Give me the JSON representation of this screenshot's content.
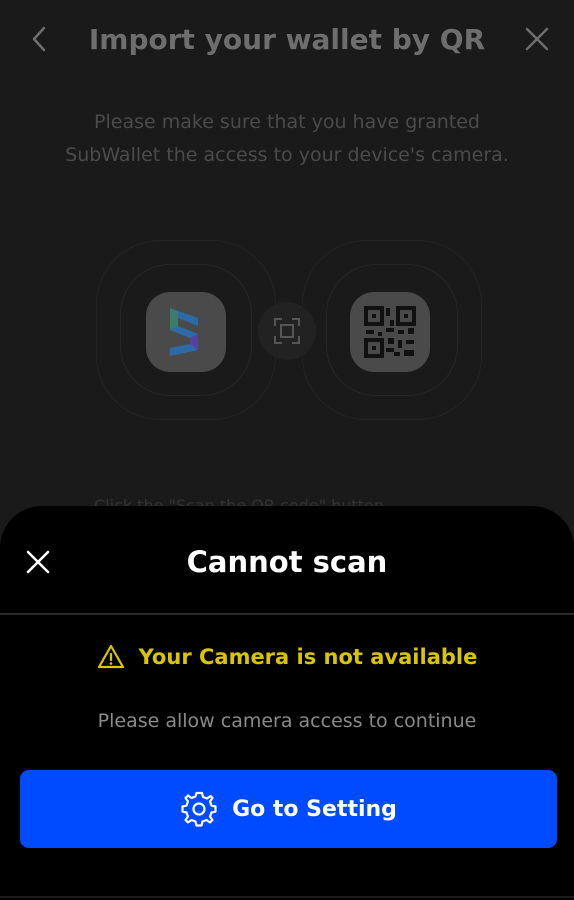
{
  "header": {
    "title": "Import your wallet by QR",
    "back_icon": "chevron-left-icon",
    "close_icon": "close-icon"
  },
  "page": {
    "description": "Please make sure that you have granted SubWallet the access to your device's camera.",
    "partial_text": "Click the \"Scan the QR code\" button"
  },
  "sheet": {
    "title": "Cannot scan",
    "warning": "Your Camera is not available",
    "message": "Please allow camera access to continue",
    "button_label": "Go to Setting",
    "button_icon": "gear-icon",
    "warning_icon": "warning-icon"
  },
  "colors": {
    "primary": "#004bff",
    "warning": "#d9c500",
    "sheet_bg": "#000000",
    "page_bg": "#1a1a1a"
  }
}
